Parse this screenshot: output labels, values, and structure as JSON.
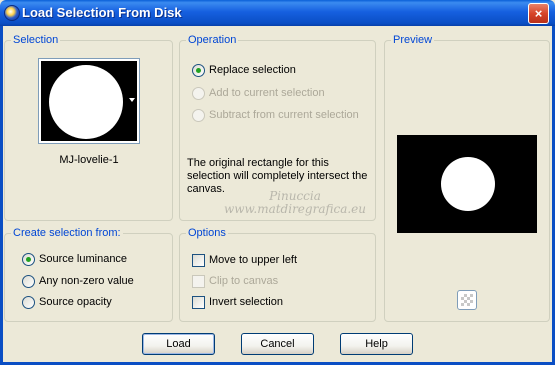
{
  "window": {
    "title": "Load Selection From Disk",
    "close_label": "×"
  },
  "selection": {
    "group_title": "Selection",
    "file_name": "MJ-lovelie-1"
  },
  "operation": {
    "group_title": "Operation",
    "options": [
      {
        "label": "Replace selection",
        "checked": true,
        "enabled": true
      },
      {
        "label": "Add to current selection",
        "checked": false,
        "enabled": false
      },
      {
        "label": "Subtract from current selection",
        "checked": false,
        "enabled": false
      }
    ],
    "info": "The original rectangle for this selection will completely intersect the canvas."
  },
  "preview": {
    "group_title": "Preview"
  },
  "create_from": {
    "group_title": "Create selection from:",
    "options": [
      {
        "label": "Source luminance",
        "checked": true
      },
      {
        "label": "Any non-zero value",
        "checked": false
      },
      {
        "label": "Source opacity",
        "checked": false
      }
    ]
  },
  "options": {
    "group_title": "Options",
    "items": [
      {
        "label": "Move to upper left",
        "checked": false,
        "enabled": true
      },
      {
        "label": "Clip to canvas",
        "checked": false,
        "enabled": false
      },
      {
        "label": "Invert selection",
        "checked": false,
        "enabled": true
      }
    ]
  },
  "watermark": {
    "line1": "Pinuccia",
    "line2": "www.matdiregrafica.eu"
  },
  "buttons": {
    "load": "Load",
    "cancel": "Cancel",
    "help": "Help"
  },
  "colors": {
    "titlebar": "#0a4ec4",
    "group_title": "#0046d5",
    "radio_checked": "#21a121"
  }
}
